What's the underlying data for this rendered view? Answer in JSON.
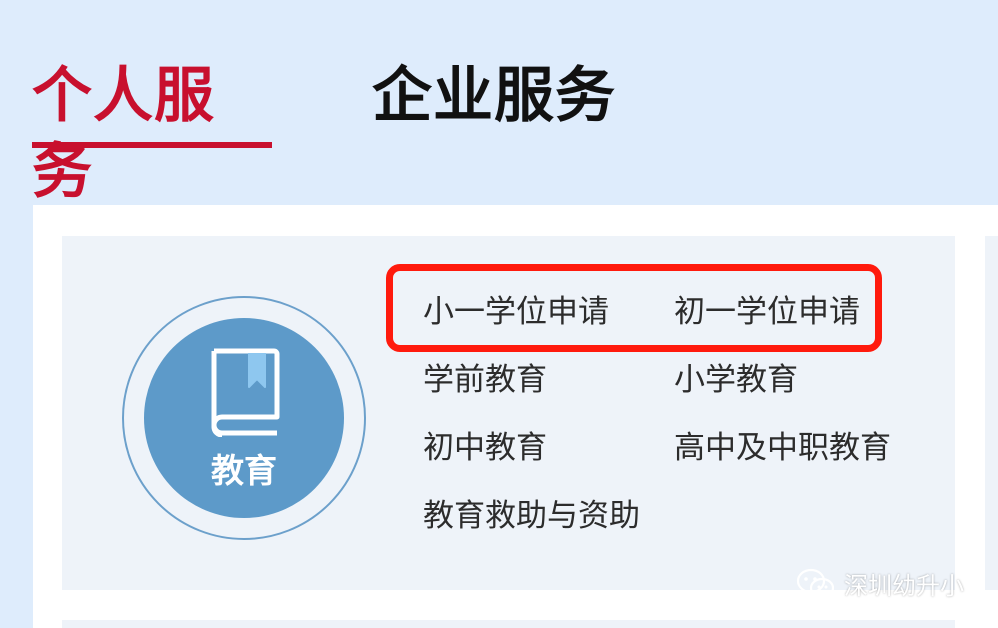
{
  "tabs": [
    {
      "label": "个人服务",
      "active": true
    },
    {
      "label": "企业服务",
      "active": false
    }
  ],
  "category": {
    "label": "教育",
    "icon": "book-icon"
  },
  "links": [
    "小一学位申请",
    "初一学位申请",
    "学前教育",
    "小学教育",
    "初中教育",
    "高中及中职教育",
    "教育救助与资助"
  ],
  "watermark": {
    "text": "深圳幼升小",
    "icon": "wechat-icon"
  },
  "colors": {
    "accent": "#c8102e",
    "circle": "#5d9ac9",
    "highlight": "#ff1a0d",
    "background": "#deecfc"
  }
}
